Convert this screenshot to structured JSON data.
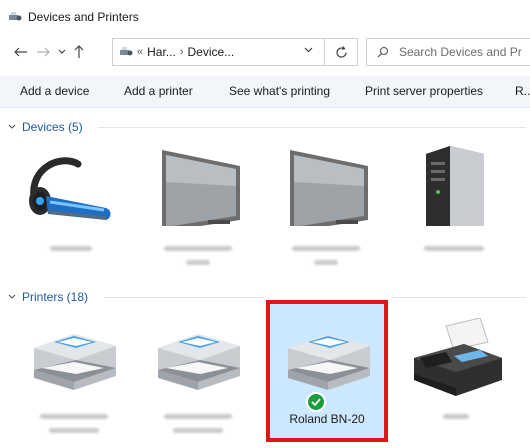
{
  "window": {
    "title": "Devices and Printers"
  },
  "nav": {
    "breadcrumbs": [
      "«",
      "Har...",
      "›",
      "Device..."
    ],
    "search_placeholder": "Search Devices and Pr"
  },
  "toolbar": {
    "add_device": "Add a device",
    "add_printer": "Add a printer",
    "see_printing": "See what's printing",
    "print_server": "Print server properties",
    "more": "R..."
  },
  "groups": {
    "devices": {
      "label": "Devices (5)"
    },
    "printers": {
      "label": "Printers (18)"
    }
  },
  "devices": [
    {
      "icon": "headset-icon",
      "name": ""
    },
    {
      "icon": "monitor-icon",
      "name": ""
    },
    {
      "icon": "monitor-icon",
      "name": ""
    },
    {
      "icon": "server-tower-icon",
      "name": ""
    }
  ],
  "printers": [
    {
      "icon": "printer-icon",
      "name": ""
    },
    {
      "icon": "printer-icon",
      "name": ""
    },
    {
      "icon": "printer-icon",
      "name": "Roland BN-20",
      "default": true,
      "selected": true
    },
    {
      "icon": "fax-icon",
      "name": ""
    }
  ],
  "colors": {
    "accent": "#1e5aa8",
    "selection_bg": "#cce8ff",
    "highlight_border": "#e0161a",
    "default_check": "#1c9e3c"
  }
}
